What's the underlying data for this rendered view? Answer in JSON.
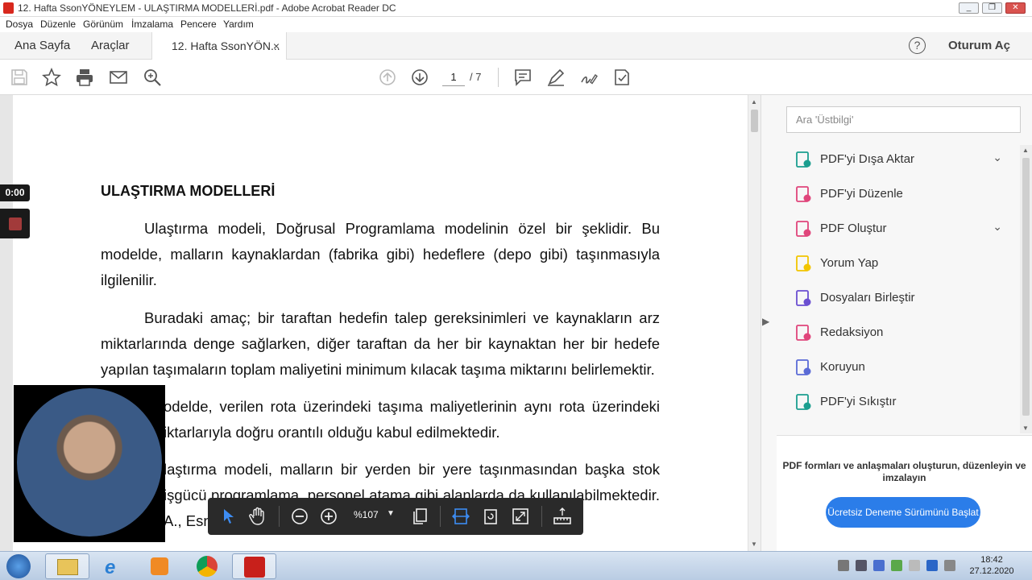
{
  "window": {
    "title": "12. Hafta SsonYÖNEYLEM - ULAŞTIRMA MODELLERİ.pdf - Adobe Acrobat Reader DC"
  },
  "menu": [
    "Dosya",
    "Düzenle",
    "Görünüm",
    "İmzalama",
    "Pencere",
    "Yardım"
  ],
  "tabs": {
    "home": "Ana Sayfa",
    "tools": "Araçlar",
    "document": "12. Hafta SsonYÖN...",
    "close": "×"
  },
  "header_right": {
    "help": "?",
    "signin": "Oturum Aç"
  },
  "toolbar": {
    "page_current": "1",
    "page_total": "/ 7"
  },
  "document": {
    "heading": "ULAŞTIRMA MODELLERİ",
    "paragraphs": [
      [
        "Ulaştırma modeli, Doğrusal Programlama modelinin özel bir şeklidir. Bu",
        "modelde, malların kaynaklardan (fabrika gibi) hedeflere (depo gibi) taşınmasıyla",
        "ilgilenilir."
      ],
      [
        "Buradaki amaç; bir taraftan hedefin talep gereksinimleri ve kaynakların arz",
        "miktarlarında denge sağlarken, diğer taraftan da her bir kaynaktan her bir hedefe",
        "yapılan taşımaların toplam maliyetini minimum kılacak taşıma miktarını belirlemektir."
      ],
      [
        "odelde, verilen rota üzerindeki taşıma maliyetlerinin aynı rota üzerindeki",
        "iktarlarıyla doğru orantılı olduğu kabul edilmektedir."
      ],
      [
        "laştırma modeli, malların bir yerden bir yere taşınmasından başka stok",
        "işgücü programlama, personel atama gibi alanlarda da kullanılabilmektedir.",
        "A., Esn"
      ]
    ]
  },
  "side_panel": {
    "search_placeholder": "Ara 'Üstbilgi'",
    "tools": [
      {
        "label": "PDF'yi Dışa Aktar",
        "icon": "export-pdf-icon",
        "color": "#1b9e8f",
        "expandable": true
      },
      {
        "label": "PDF'yi Düzenle",
        "icon": "edit-pdf-icon",
        "color": "#e0457b",
        "expandable": false
      },
      {
        "label": "PDF Oluştur",
        "icon": "create-pdf-icon",
        "color": "#e0457b",
        "expandable": true
      },
      {
        "label": "Yorum Yap",
        "icon": "comment-icon",
        "color": "#f2c500",
        "expandable": false
      },
      {
        "label": "Dosyaları Birleştir",
        "icon": "combine-files-icon",
        "color": "#6b4fd1",
        "expandable": false
      },
      {
        "label": "Redaksiyon",
        "icon": "redact-icon",
        "color": "#e0457b",
        "expandable": false
      },
      {
        "label": "Koruyun",
        "icon": "protect-shield-icon",
        "color": "#5b6bd6",
        "expandable": false
      },
      {
        "label": "PDF'yi Sıkıştır",
        "icon": "compress-pdf-icon",
        "color": "#1b9e8f",
        "expandable": false
      }
    ],
    "promo_text": "PDF formları ve anlaşmaları oluşturun, düzenleyin ve imzalayın",
    "promo_button": "Ücretsiz Deneme Sürümünü Başlat"
  },
  "recorder": {
    "time": "0:00"
  },
  "floating_toolbar": {
    "zoom": "%107"
  },
  "taskbar": {
    "time": "18:42",
    "date": "27.12.2020"
  }
}
